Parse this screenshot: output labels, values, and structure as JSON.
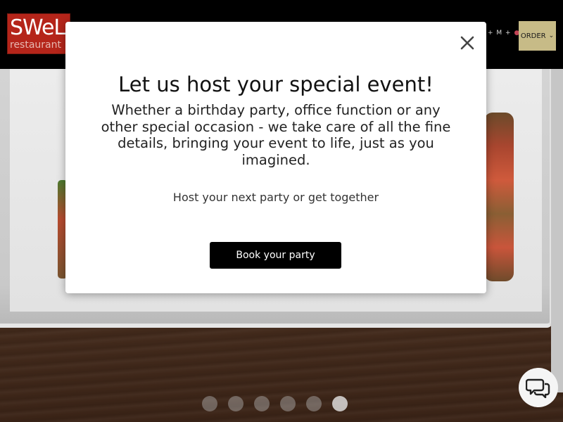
{
  "header": {
    "logo_text": "SWeL",
    "logo_subtext": "restaurant",
    "nav_icons_text": "+ M +",
    "order_label": "ORDER",
    "order_chevron": "⌄"
  },
  "modal": {
    "close_glyph": "✕",
    "title": "Let us host your special event!",
    "body": "Whether a birthday party, office function or any other special occasion - we take care of all the fine details, bringing your event to life, just as you imagined.",
    "subtitle": "Host your next party or get together",
    "cta_label": "Book your party"
  },
  "carousel": {
    "dot_count": 6,
    "active_index": 5
  },
  "colors": {
    "header_bg": "#000000",
    "logo_bg": "#b5251a",
    "order_bg": "#c7bb87",
    "cta_bg": "#000000"
  },
  "icons": {
    "close": "close-icon",
    "chat": "chat-icon",
    "chevron": "chevron-down-icon",
    "bag": "shopping-bag-icon"
  }
}
